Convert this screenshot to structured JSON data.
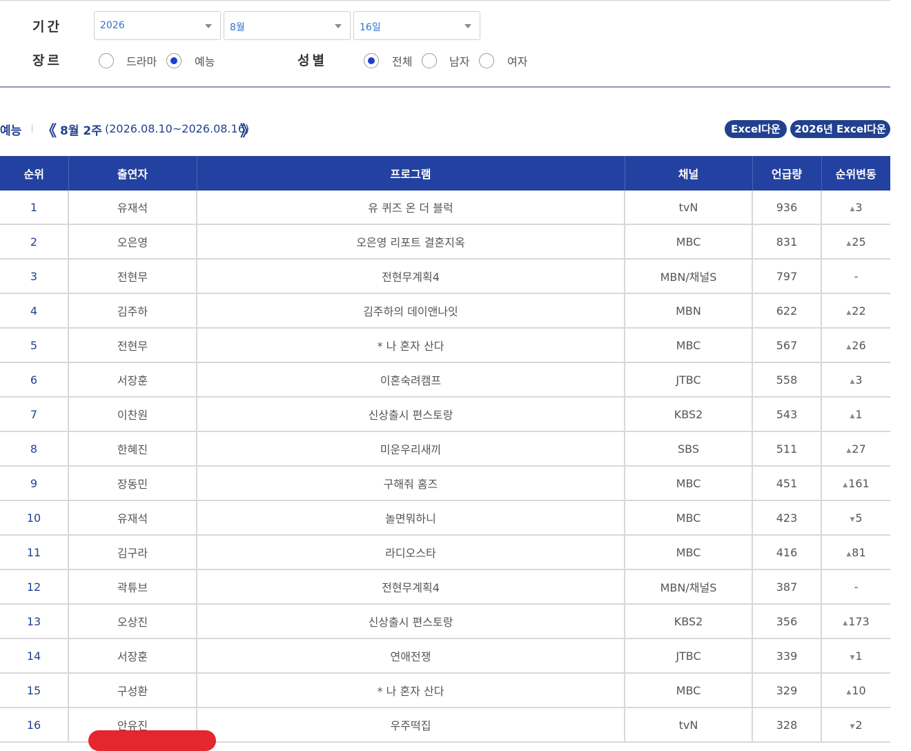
{
  "filters": {
    "period_label": "기간",
    "year_value": "2026",
    "month_value": "8월",
    "day_value": "16일",
    "genre_label": "장르",
    "genre_options": [
      {
        "label": "드라마",
        "selected": false
      },
      {
        "label": "예능",
        "selected": true
      }
    ],
    "gender_label": "성별",
    "gender_options": [
      {
        "label": "전체",
        "selected": true
      },
      {
        "label": "남자",
        "selected": false
      },
      {
        "label": "여자",
        "selected": false
      }
    ]
  },
  "week": {
    "genre": "예능",
    "prev_arrow": "《",
    "label": "8월 2주",
    "range": "(2026.08.10~2026.08.16)",
    "next_arrow": "》"
  },
  "buttons": {
    "excel": "Excel다운",
    "excel_year": "2026년 Excel다운"
  },
  "table": {
    "headers": [
      "순위",
      "출연자",
      "프로그램",
      "채널",
      "언급량",
      "순위변동"
    ],
    "rows": [
      {
        "rank": "1",
        "person": "유재석",
        "program": "유 퀴즈 온 더 블럭",
        "channel": "tvN",
        "mentions": "936",
        "dir": "up",
        "change": "3"
      },
      {
        "rank": "2",
        "person": "오은영",
        "program": "오은영 리포트 결혼지옥",
        "channel": "MBC",
        "mentions": "831",
        "dir": "up",
        "change": "25"
      },
      {
        "rank": "3",
        "person": "전현무",
        "program": "전현무계획4",
        "channel": "MBN/채널S",
        "mentions": "797",
        "dir": "none",
        "change": "-"
      },
      {
        "rank": "4",
        "person": "김주하",
        "program": "김주하의 데이앤나잇",
        "channel": "MBN",
        "mentions": "622",
        "dir": "up",
        "change": "22"
      },
      {
        "rank": "5",
        "person": "전현무",
        "program": "* 나 혼자 산다",
        "channel": "MBC",
        "mentions": "567",
        "dir": "up",
        "change": "26"
      },
      {
        "rank": "6",
        "person": "서장훈",
        "program": "이혼숙려캠프",
        "channel": "JTBC",
        "mentions": "558",
        "dir": "up",
        "change": "3"
      },
      {
        "rank": "7",
        "person": "이찬원",
        "program": "신상출시 편스토랑",
        "channel": "KBS2",
        "mentions": "543",
        "dir": "up",
        "change": "1"
      },
      {
        "rank": "8",
        "person": "한혜진",
        "program": "미운우리새끼",
        "channel": "SBS",
        "mentions": "511",
        "dir": "up",
        "change": "27"
      },
      {
        "rank": "9",
        "person": "장동민",
        "program": "구해줘 홈즈",
        "channel": "MBC",
        "mentions": "451",
        "dir": "up",
        "change": "161"
      },
      {
        "rank": "10",
        "person": "유재석",
        "program": "놀면뭐하니",
        "channel": "MBC",
        "mentions": "423",
        "dir": "down",
        "change": "5"
      },
      {
        "rank": "11",
        "person": "김구라",
        "program": "라디오스타",
        "channel": "MBC",
        "mentions": "416",
        "dir": "up",
        "change": "81"
      },
      {
        "rank": "12",
        "person": "곽튜브",
        "program": "전현무계획4",
        "channel": "MBN/채널S",
        "mentions": "387",
        "dir": "none",
        "change": "-"
      },
      {
        "rank": "13",
        "person": "오상진",
        "program": "신상출시 편스토랑",
        "channel": "KBS2",
        "mentions": "356",
        "dir": "up",
        "change": "173"
      },
      {
        "rank": "14",
        "person": "서장훈",
        "program": "연애전쟁",
        "channel": "JTBC",
        "mentions": "339",
        "dir": "down",
        "change": "1"
      },
      {
        "rank": "15",
        "person": "구성환",
        "program": "* 나 혼자 산다",
        "channel": "MBC",
        "mentions": "329",
        "dir": "up",
        "change": "10"
      },
      {
        "rank": "16",
        "person": "안유진",
        "program": "우주떡집",
        "channel": "tvN",
        "mentions": "328",
        "dir": "down",
        "change": "2"
      }
    ]
  },
  "colors": {
    "header_bg": "#2341a0",
    "accent": "#22418f",
    "radio_on": "#1f3fd1",
    "highlight": "#e5262e"
  }
}
